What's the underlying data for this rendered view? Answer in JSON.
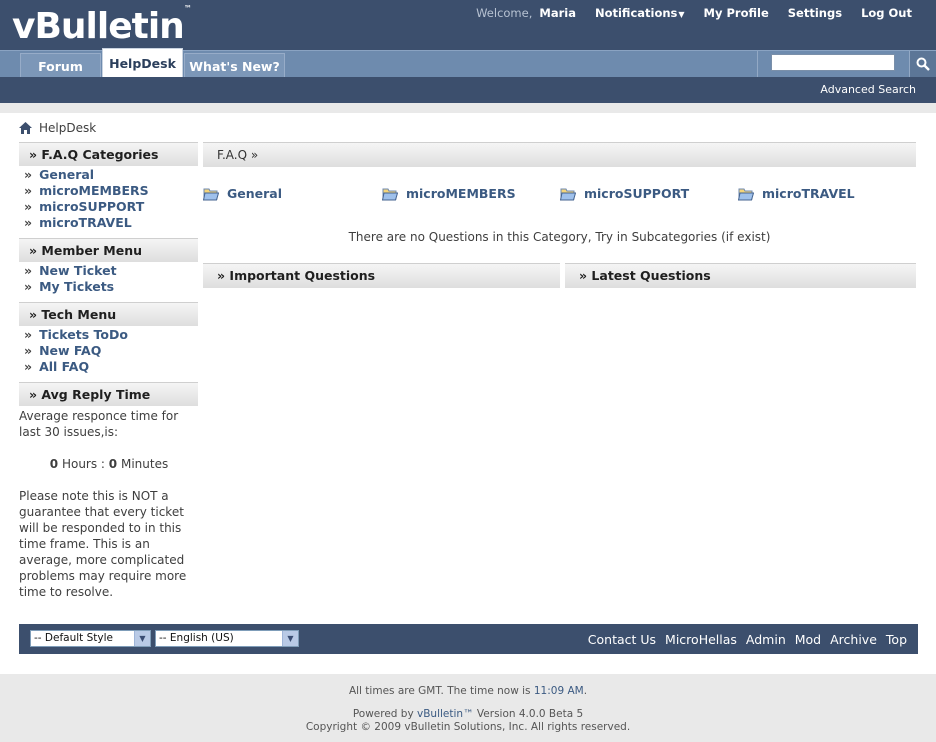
{
  "brand": {
    "logo": "vBulletin",
    "tm": "™"
  },
  "toplinks": {
    "welcome": "Welcome,",
    "user": "Maria",
    "notifications": "Notifications",
    "profile": "My Profile",
    "settings": "Settings",
    "logout": "Log Out"
  },
  "tabs": [
    {
      "label": "Forum"
    },
    {
      "label": "HelpDesk"
    },
    {
      "label": "What's New?"
    }
  ],
  "search": {
    "placeholder": "",
    "advanced": "Advanced Search"
  },
  "breadcrumb": {
    "current": "HelpDesk"
  },
  "sidebar": {
    "faq": {
      "title": "» F.A.Q Categories",
      "items": [
        "General",
        "microMEMBERS",
        "microSUPPORT",
        "microTRAVEL"
      ]
    },
    "member": {
      "title": "» Member Menu",
      "items": [
        "New Ticket",
        "My Tickets"
      ]
    },
    "tech": {
      "title": "» Tech Menu",
      "items": [
        "Tickets ToDo",
        "New FAQ",
        "All FAQ"
      ]
    },
    "avg": {
      "title": "» Avg Reply Time",
      "desc": "Average responce time for last 30 issues,is:",
      "hours": "0",
      "hours_label": "Hours :",
      "minutes": "0",
      "minutes_label": "Minutes",
      "note": "Please note this is NOT a guarantee that every ticket will be responded to in this time frame. This is an average, more complicated problems may require more time to resolve."
    }
  },
  "main": {
    "faq_bar": "F.A.Q »",
    "categories": [
      "General",
      "microMEMBERS",
      "microSUPPORT",
      "microTRAVEL"
    ],
    "no_questions": "There are no Questions in this Category, Try in Subcategories (if exist)",
    "important": "» Important Questions",
    "latest": "» Latest Questions"
  },
  "footer": {
    "style_select": "-- Default Style",
    "lang_select": "-- English (US)",
    "links": [
      "Contact Us",
      "MicroHellas",
      "Admin",
      "Mod",
      "Archive",
      "Top"
    ],
    "times": "All times are GMT. The time now is",
    "time": "11:09 AM",
    "times_end": ".",
    "powered": "Powered by",
    "powered_brand": "vBulletin™",
    "version": "Version 4.0.0 Beta 5",
    "copyright": "Copyright © 2009 vBulletin Solutions, Inc. All rights reserved."
  },
  "colors": {
    "header": "#3c4f6d",
    "nav": "#6e8bae",
    "link": "#3b5a82"
  }
}
